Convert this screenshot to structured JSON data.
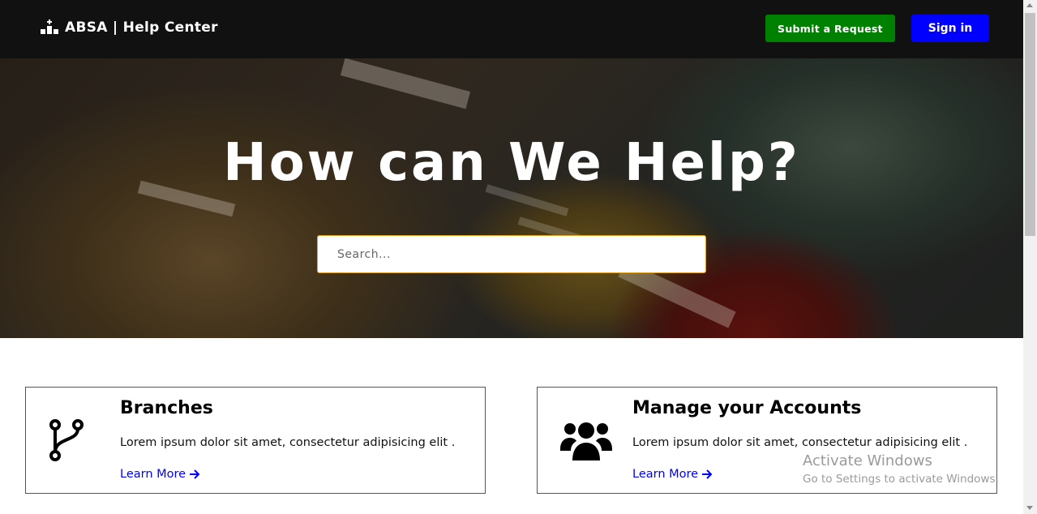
{
  "header": {
    "brand": "ABSA | Help Center",
    "submit_label": "Submit a Request",
    "signin_label": "Sign in"
  },
  "hero": {
    "title": "How can We Help?",
    "search_placeholder": "Search..."
  },
  "cards": [
    {
      "title": "Branches",
      "description": "Lorem ipsum dolor sit amet, consectetur adipisicing elit .",
      "link": "Learn More",
      "icon": "git-branch-icon"
    },
    {
      "title": "Manage your Accounts",
      "description": "Lorem ipsum dolor sit amet, consectetur adipisicing elit .",
      "link": "Learn More",
      "icon": "users-icon"
    }
  ],
  "watermark": {
    "line1": "Activate Windows",
    "line2": "Go to Settings to activate Windows."
  },
  "colors": {
    "header_bg": "#111111",
    "submit_button": "#008000",
    "signin_button": "#0000ff",
    "link": "#0000ff",
    "search_border": "#e0a020"
  }
}
